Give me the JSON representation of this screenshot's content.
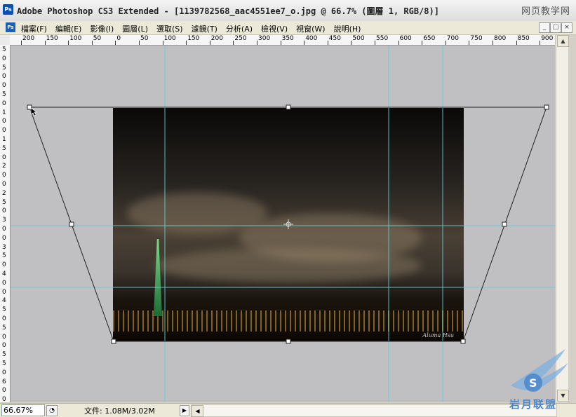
{
  "window": {
    "app_icon": "Ps",
    "title": "Adobe Photoshop CS3 Extended - [1139782568_aac4551ee7_o.jpg @ 66.7% (圖層 1, RGB/8)]",
    "watermark_top": "网页教学网"
  },
  "menubar": {
    "doc_icon": "Ps",
    "items": [
      "檔案(F)",
      "編輯(E)",
      "影像(I)",
      "圖層(L)",
      "選取(S)",
      "濾鏡(T)",
      "分析(A)",
      "檢視(V)",
      "視窗(W)",
      "說明(H)"
    ],
    "controls": [
      "_",
      "□",
      "×"
    ]
  },
  "rulers": {
    "horizontal": [
      "200",
      "150",
      "100",
      "50",
      "0",
      "50",
      "100",
      "150",
      "200",
      "250",
      "300",
      "350",
      "400",
      "450",
      "500",
      "550",
      "600",
      "650",
      "700",
      "750",
      "800",
      "850",
      "900"
    ],
    "vertical": [
      "5",
      "0",
      "5",
      "0",
      "0",
      "5",
      "0",
      "1",
      "0",
      "0",
      "1",
      "5",
      "0",
      "2",
      "0",
      "0",
      "2",
      "5",
      "0",
      "3",
      "0",
      "0",
      "3",
      "5",
      "0",
      "4",
      "0",
      "0",
      "4",
      "5",
      "0",
      "5",
      "0",
      "0",
      "5",
      "5",
      "0",
      "6",
      "0",
      "0"
    ]
  },
  "photo": {
    "signature": "Aluma Hsu"
  },
  "statusbar": {
    "zoom": "66.67%",
    "doc_info": "文件: 1.08M/3.02M",
    "arrow": "▶"
  },
  "watermark_bottom": {
    "text": "岩月联盟"
  },
  "colors": {
    "guide": "#5fd0d8",
    "canvas_bg": "#c0bfc2",
    "ui_bg": "#ece9d8"
  }
}
